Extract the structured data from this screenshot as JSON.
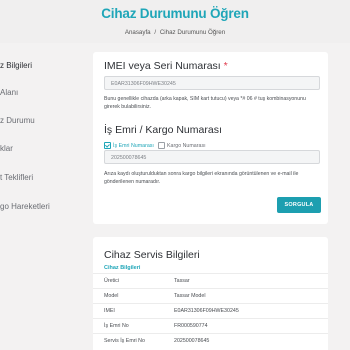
{
  "header": {
    "title": "Cihaz Durumunu Öğren",
    "breadcrumb": {
      "home": "Anasayfa",
      "separator": "/",
      "current": "Cihaz Durumunu Öğren"
    }
  },
  "sidebar": {
    "items": [
      {
        "label": "z Bilgileri"
      },
      {
        "label": "Alanı"
      },
      {
        "label": "z Durumu"
      },
      {
        "label": "klar"
      },
      {
        "label": "t Teklifleri"
      },
      {
        "label": "go Hareketleri"
      }
    ]
  },
  "query_form": {
    "imei_title": "IMEI veya Seri Numarası",
    "required_mark": "*",
    "imei_value": "E0AR31306F09HWE30245",
    "imei_help": "Bunu genellikle cihazda (arka kapak, SIM kart tutucu) veya *# 06 # tuş kombinasyonunu girerek bulabilirsiniz.",
    "order_title": "İş Emri / Kargo Numarası",
    "radio_options": [
      {
        "label": "İş Emri Numarası",
        "checked": true
      },
      {
        "label": "Kargo Numarası",
        "checked": false
      }
    ],
    "order_value": "202500078645",
    "order_help": "Arıza kaydı oluşturulduktan sonra kargo bilgileri ekranında görüntülenen ve e-mail ile gönderilenen numaradır.",
    "submit_label": "SORGULA"
  },
  "service_info": {
    "title": "Cihaz Servis Bilgileri",
    "subtitle": "Cihaz Bilgileri",
    "rows": [
      {
        "label": "Üretici",
        "value": "Tassar"
      },
      {
        "label": "Model",
        "value": "Tassar Model"
      },
      {
        "label": "IMEI",
        "value": "E0AR31306F09HWE30245"
      },
      {
        "label": "İş Emri No",
        "value": "FR000590774"
      },
      {
        "label": "Servis İş Emri No",
        "value": "202500078645"
      }
    ]
  },
  "colors": {
    "accent": "#1fa6b8",
    "button": "#1d9fb0",
    "required": "#e0394b"
  }
}
